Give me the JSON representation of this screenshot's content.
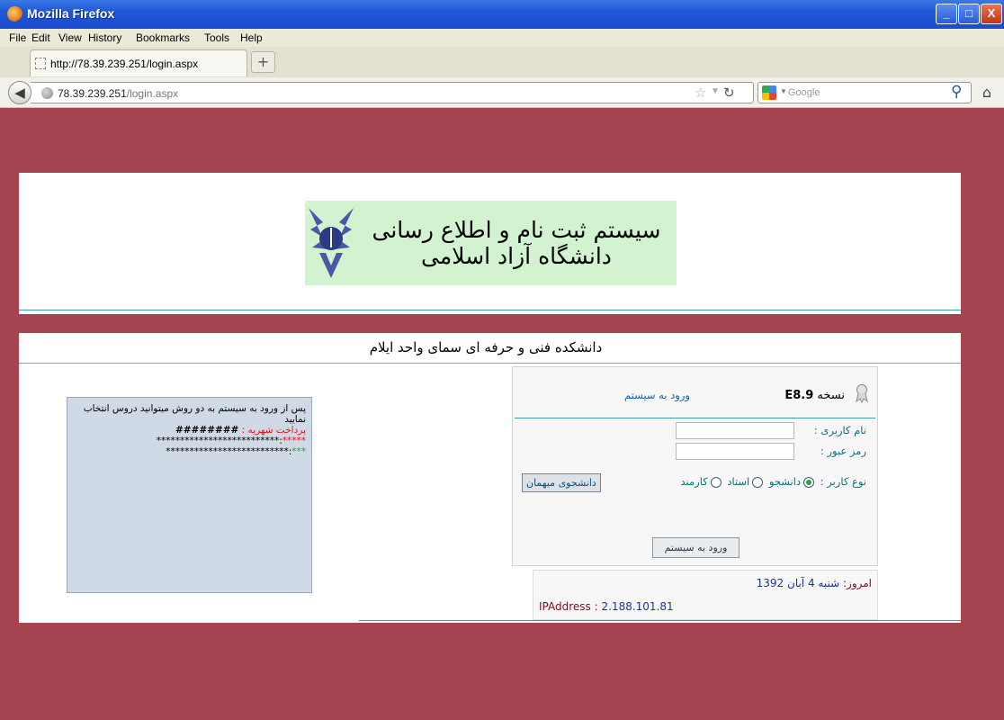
{
  "window": {
    "title": "Mozilla Firefox",
    "minimize": "_",
    "maximize": "□",
    "close": "X"
  },
  "menu": [
    "File",
    "Edit",
    "View",
    "History",
    "Bookmarks",
    "Tools",
    "Help"
  ],
  "tab": {
    "label": "http://78.39.239.251/login.aspx",
    "new_tab": "+"
  },
  "nav": {
    "url_host": "78.39.239.251",
    "url_path": "/login.aspx",
    "search_placeholder": "Google"
  },
  "banner": {
    "title": "سیستم ثبت نام و اطلاع رسانی دانشگاه آزاد اسلامی"
  },
  "college": {
    "name": "دانشکده فنی و حرفه ای سمای واحد ایلام"
  },
  "notice": {
    "line1": "پس از ورود به سیستم به دو روش میتوانید دروس انتخاب نمایید",
    "line2_label": "پرداخت شهریه : ",
    "line2_value": "########",
    "line3_a": "*****",
    "line3_b": ":**************************",
    "line4_a": "***",
    "line4_b": ":**************************"
  },
  "login": {
    "version_label": "نسخه",
    "version": "E8.9",
    "heading": "ورود به سیستم",
    "username_label": "نام کاربری :",
    "username_value": "",
    "password_label": "رمز عبور :",
    "password_value": "",
    "user_type_label": "نوع کاربر :",
    "options": [
      "دانشجو",
      "استاد",
      "کارمند"
    ],
    "selected_option": "دانشجو",
    "guest_button": "دانشجوی میهمان",
    "submit_button": "ورود به سیستم"
  },
  "info": {
    "date_label": "امروز:",
    "date_value": "شنبه 4 آبان 1392",
    "ip_label": "IPAddress :",
    "ip_value": "2.188.101.81"
  }
}
